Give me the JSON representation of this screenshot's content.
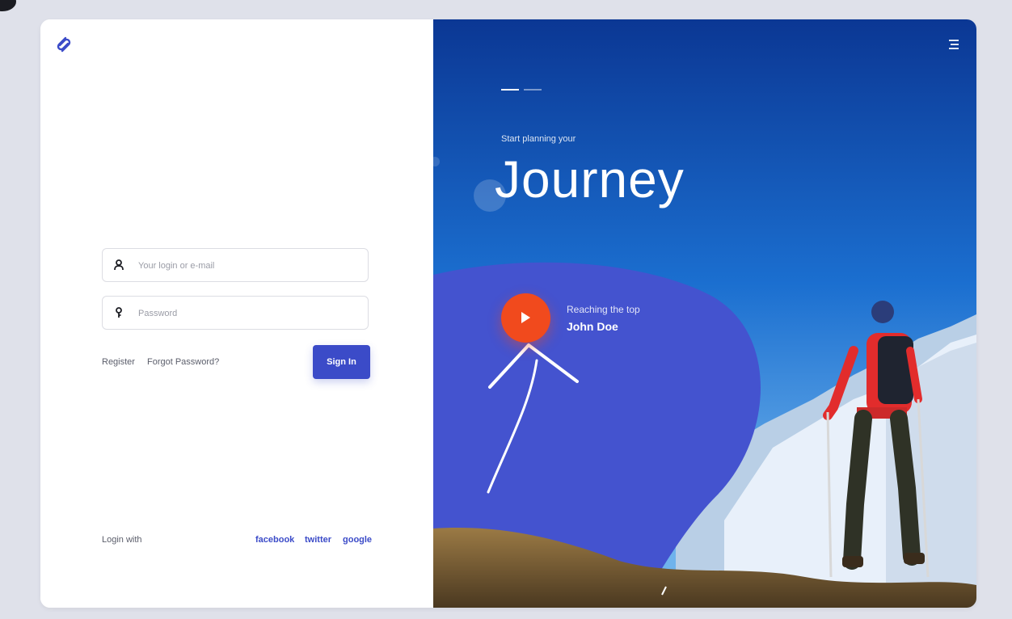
{
  "login": {
    "username_placeholder": "Your login or e-mail",
    "password_placeholder": "Password",
    "register_label": "Register",
    "forgot_label": "Forgot Password?",
    "signin_label": "Sign In",
    "login_with_label": "Login with",
    "social": [
      "facebook",
      "twitter",
      "google"
    ]
  },
  "hero": {
    "subtitle": "Start planning your",
    "headline": "Journey",
    "video_caption": "Reaching the top",
    "video_author": "John Doe"
  },
  "icons": {
    "logo": "logo-icon",
    "user": "user-icon",
    "key": "key-icon",
    "menu": "menu-icon",
    "play": "play-icon"
  },
  "colors": {
    "accent": "#3b4bc8",
    "play": "#f14a1d",
    "sky_top": "#0d3a9a",
    "blob": "#4453cf"
  }
}
